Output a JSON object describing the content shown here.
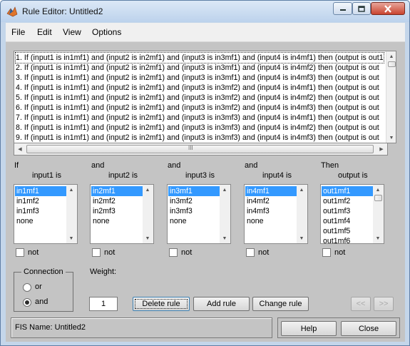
{
  "window": {
    "title": "Rule Editor: Untitled2",
    "controls": {
      "minimize": "minimize-icon",
      "maximize": "maximize-icon",
      "close": "close-icon"
    }
  },
  "menu": [
    "File",
    "Edit",
    "View",
    "Options"
  ],
  "rules": [
    "1. If (input1 is in1mf1) and (input2 is in2mf1) and (input3 is in3mf1) and (input4 is in4mf1) then (output is out1",
    "2. If (input1 is in1mf1) and (input2 is in2mf1) and (input3 is in3mf1) and (input4 is in4mf2) then (output is out",
    "3. If (input1 is in1mf1) and (input2 is in2mf1) and (input3 is in3mf1) and (input4 is in4mf3) then (output is out",
    "4. If (input1 is in1mf1) and (input2 is in2mf1) and (input3 is in3mf2) and (input4 is in4mf1) then (output is out",
    "5. If (input1 is in1mf1) and (input2 is in2mf1) and (input3 is in3mf2) and (input4 is in4mf2) then (output is out",
    "6. If (input1 is in1mf1) and (input2 is in2mf1) and (input3 is in3mf2) and (input4 is in4mf3) then (output is out",
    "7. If (input1 is in1mf1) and (input2 is in2mf1) and (input3 is in3mf3) and (input4 is in4mf1) then (output is out",
    "8. If (input1 is in1mf1) and (input2 is in2mf1) and (input3 is in3mf3) and (input4 is in4mf2) then (output is out",
    "9. If (input1 is in1mf1) and (input2 is in2mf1) and (input3 is in3mf3) and (input4 is in4mf3) then (output is out"
  ],
  "hscroll_grip": "III",
  "columns": [
    {
      "connector": "If",
      "label": "input1 is",
      "items": [
        "in1mf1",
        "in1mf2",
        "in1mf3",
        "none"
      ],
      "selected": 0,
      "not_label": "not"
    },
    {
      "connector": "and",
      "label": "input2 is",
      "items": [
        "in2mf1",
        "in2mf2",
        "in2mf3",
        "none"
      ],
      "selected": 0,
      "not_label": "not"
    },
    {
      "connector": "and",
      "label": "input3 is",
      "items": [
        "in3mf1",
        "in3mf2",
        "in3mf3",
        "none"
      ],
      "selected": 0,
      "not_label": "not"
    },
    {
      "connector": "and",
      "label": "input4 is",
      "items": [
        "in4mf1",
        "in4mf2",
        "in4mf3",
        "none"
      ],
      "selected": 0,
      "not_label": "not"
    },
    {
      "connector": "Then",
      "label": "output is",
      "items": [
        "out1mf1",
        "out1mf2",
        "out1mf3",
        "out1mf4",
        "out1mf5",
        "out1mf6"
      ],
      "selected": 0,
      "not_label": "not"
    }
  ],
  "connection": {
    "title": "Connection",
    "options": [
      "or",
      "and"
    ],
    "selected": "and"
  },
  "weight": {
    "label": "Weight:",
    "value": "1"
  },
  "buttons": {
    "delete": "Delete rule",
    "add": "Add rule",
    "change": "Change rule",
    "prev": "<<",
    "next": ">>",
    "help": "Help",
    "close": "Close"
  },
  "status": "FIS Name: Untitled2"
}
